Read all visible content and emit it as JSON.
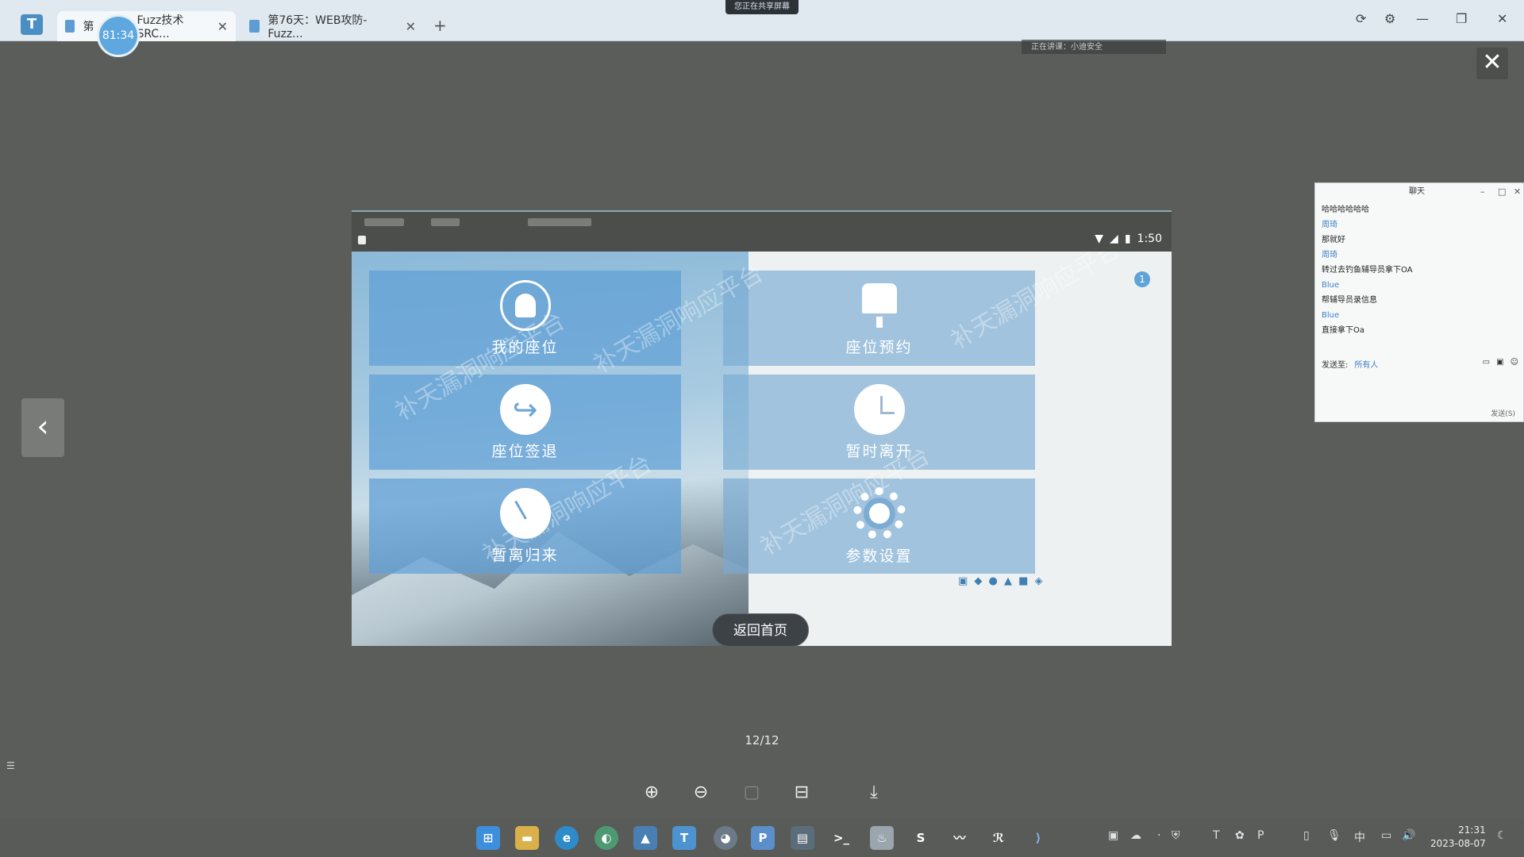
{
  "browser": {
    "tabs": [
      {
        "label": "第",
        "label_tail": "Fuzz技术SRC...",
        "active": true
      },
      {
        "label": "第76天：WEB攻防-Fuzz...",
        "active": false
      }
    ],
    "timer": "81:34",
    "share_banner": "您正在共享屏幕",
    "sub_strip": "正在讲课：小迪安全"
  },
  "viewer": {
    "counter": "12/12",
    "tools": [
      "zoom-in",
      "zoom-out",
      "fit",
      "rotate",
      "download"
    ]
  },
  "phone": {
    "status_time": "1:50",
    "tiles": [
      {
        "label": "我的座位",
        "icon": "user-icon"
      },
      {
        "label": "座位预约",
        "icon": "chair-icon"
      },
      {
        "label": "座位签退",
        "icon": "signout-icon"
      },
      {
        "label": "暂时离开",
        "icon": "clock-icon"
      },
      {
        "label": "暂离归来",
        "icon": "timer-icon"
      },
      {
        "label": "参数设置",
        "icon": "gear-icon"
      }
    ],
    "notification_count": "1",
    "watermark": "补天漏洞响应平台",
    "home_button": "返回首页"
  },
  "chat": {
    "title": "聊天",
    "messages": [
      {
        "name": "",
        "text": "哈哈哈哈哈哈"
      },
      {
        "name": "周琦",
        "text": "那就好"
      },
      {
        "name": "周琦",
        "text": "转过去钓鱼辅导员拿下OA"
      },
      {
        "name": "Blue",
        "text": "帮辅导员录信息"
      },
      {
        "name": "Blue",
        "text": "直接拿下Oa"
      }
    ],
    "send_to_label": "发送至:",
    "send_to_value": "所有人",
    "send_button": "发送(S)"
  },
  "taskbar": {
    "time": "21:31",
    "date": "2023-08-07",
    "ime": "中"
  }
}
